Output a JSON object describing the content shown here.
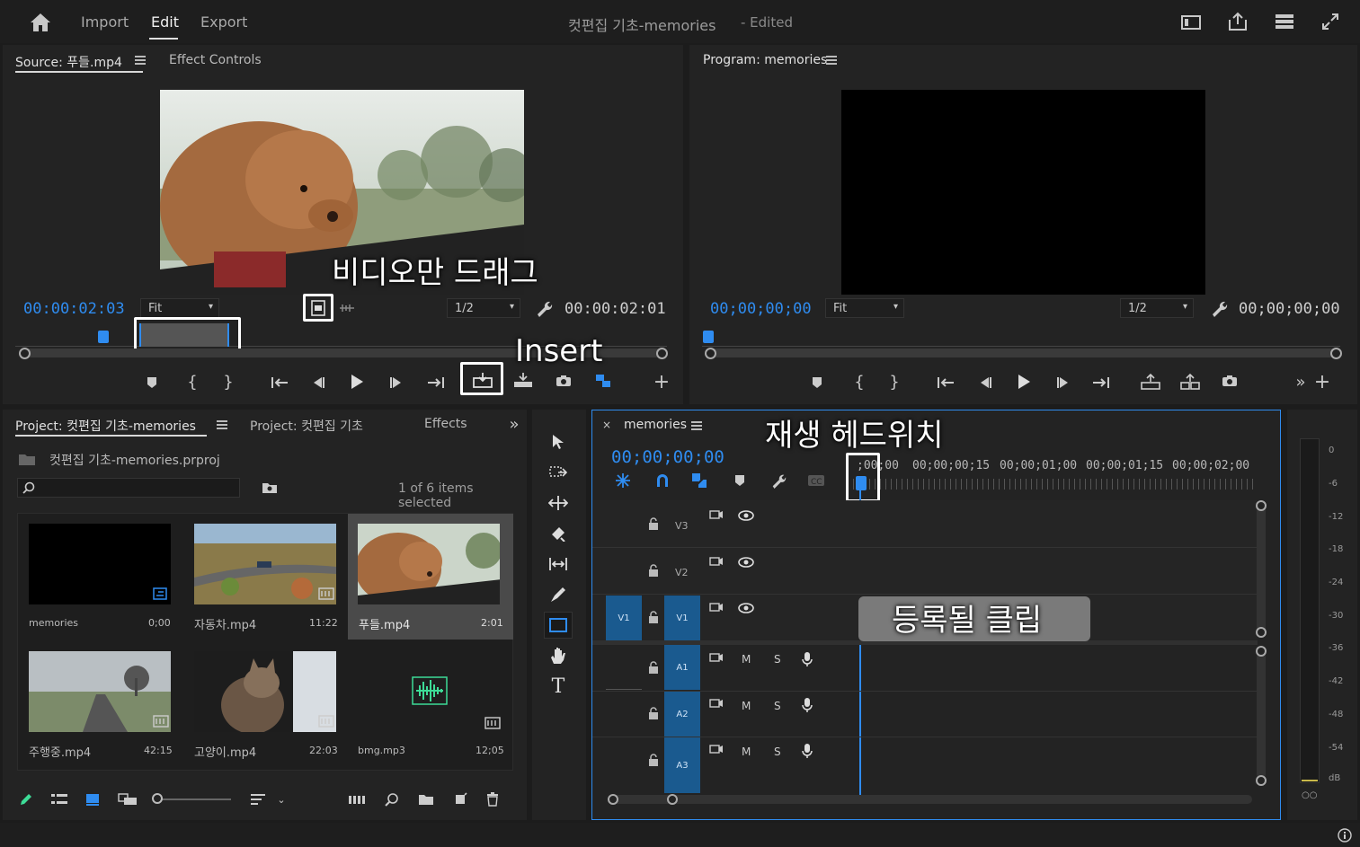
{
  "topbar": {
    "nav": [
      "Import",
      "Edit",
      "Export"
    ],
    "active_nav": "Edit",
    "title": "컷편집 기초-memories",
    "title_suffix": "- Edited"
  },
  "source": {
    "tab_label": "Source: 푸들.mp4",
    "effect_tab": "Effect Controls",
    "timecode_in": "00:00:02:03",
    "fit": "Fit",
    "resolution": "1/2",
    "timecode_out": "00:00:02:01",
    "overlay_drag": "비디오만 드래그",
    "overlay_insert": "Insert"
  },
  "program": {
    "tab_label": "Program: memories",
    "timecode_in": "00;00;00;00",
    "fit": "Fit",
    "resolution": "1/2",
    "timecode_out": "00;00;00;00"
  },
  "project": {
    "tab_label": "Project: 컷편집 기초-memories",
    "tab2": "Project: 컷편집 기초",
    "tab3": "Effects",
    "file": "컷편집 기초-memories.prproj",
    "search_placeholder": "",
    "selected_info": "1 of 6 items selected",
    "items": [
      {
        "name": "memories",
        "duration": "0;00"
      },
      {
        "name": "자동차.mp4",
        "duration": "11:22"
      },
      {
        "name": "푸들.mp4",
        "duration": "2:01"
      },
      {
        "name": "주행중.mp4",
        "duration": "42:15"
      },
      {
        "name": "고양이.mp4",
        "duration": "22:03"
      },
      {
        "name": "bmg.mp3",
        "duration": "12;05"
      }
    ]
  },
  "timeline": {
    "tab_label": "memories",
    "timecode": "00;00;00;00",
    "overlay_playhead": "재생 헤드위치",
    "overlay_clip": "등록될 클립",
    "ruler": [
      ";00;00",
      "00;00;00;15",
      "00;00;01;00",
      "00;00;01;15",
      "00;00;02;00"
    ],
    "video_tracks": [
      {
        "target": "",
        "name": "V3"
      },
      {
        "target": "",
        "name": "V2"
      },
      {
        "target": "V1",
        "name": "V1"
      }
    ],
    "audio_tracks": [
      {
        "name": "A1",
        "m": "M",
        "s": "S"
      },
      {
        "name": "A2",
        "m": "M",
        "s": "S"
      },
      {
        "name": "A3",
        "m": "M",
        "s": "S"
      }
    ]
  },
  "meter": {
    "labels": [
      "0",
      "-6",
      "-12",
      "-18",
      "-24",
      "-30",
      "-36",
      "-42",
      "-48",
      "-54",
      "dB"
    ]
  },
  "colors": {
    "accent": "#2f8cf0",
    "panel": "#232323",
    "track_target": "#1a5a8f"
  }
}
